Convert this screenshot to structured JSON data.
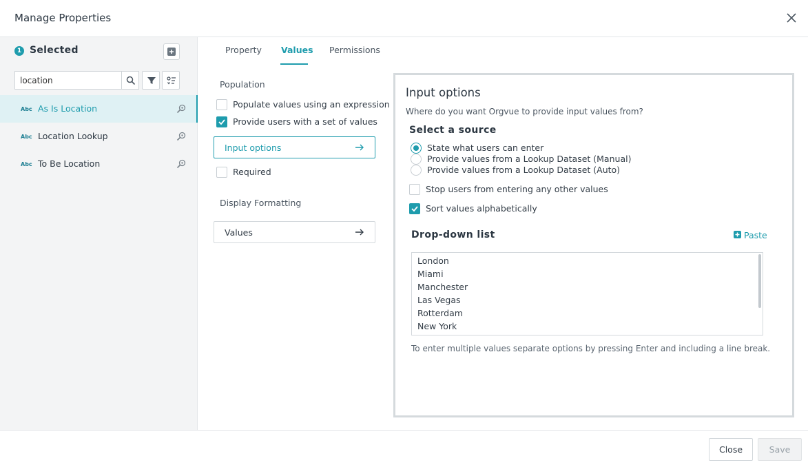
{
  "dialog": {
    "title": "Manage Properties"
  },
  "sidebar": {
    "selected_count": "1",
    "selected_label": "Selected",
    "search": {
      "value": "location",
      "placeholder": ""
    },
    "items": [
      {
        "type_badge": "Abc",
        "label": "As Is Location",
        "active": true
      },
      {
        "type_badge": "Abc",
        "label": "Location Lookup",
        "active": false
      },
      {
        "type_badge": "Abc",
        "label": "To Be Location",
        "active": false
      }
    ]
  },
  "tabs": [
    {
      "label": "Property",
      "active": false
    },
    {
      "label": "Values",
      "active": true
    },
    {
      "label": "Permissions",
      "active": false
    }
  ],
  "values_tab": {
    "population_label": "Population",
    "populate_expression": {
      "label": "Populate values using an expression",
      "checked": false
    },
    "provide_set": {
      "label": "Provide users with a set of values",
      "checked": true
    },
    "input_options_button": "Input options",
    "required": {
      "label": "Required",
      "checked": false
    },
    "display_formatting_label": "Display Formatting",
    "values_button": "Values"
  },
  "input_options": {
    "title": "Input options",
    "subtitle": "Where do you want Orgvue to provide input values from?",
    "source_title": "Select a source",
    "sources": [
      {
        "label": "State what users can enter",
        "selected": true
      },
      {
        "label": "Provide values from a Lookup Dataset (Manual)",
        "selected": false
      },
      {
        "label": "Provide values from a Lookup Dataset (Auto)",
        "selected": false
      }
    ],
    "stop_other": {
      "label": "Stop users from entering any other values",
      "checked": false
    },
    "sort_alpha": {
      "label": "Sort values alphabetically",
      "checked": true
    },
    "dropdown_title": "Drop-down list",
    "paste_label": "Paste",
    "options": [
      "London",
      "Miami",
      "Manchester",
      "Las Vegas",
      "Rotterdam",
      "New York"
    ],
    "hint": "To enter multiple values separate options by pressing Enter and including a line break."
  },
  "footer": {
    "close_label": "Close",
    "save_label": "Save"
  },
  "colors": {
    "accent": "#1e9cad",
    "sidebar_bg": "#f3f4f5",
    "active_row": "#dff1f4"
  },
  "icons": {
    "close": "close-icon",
    "add": "add-icon",
    "search": "search-icon",
    "filter": "filter-icon",
    "sort": "sort-icon",
    "inspect": "zoom-icon",
    "arrow": "arrow-right-icon",
    "paste": "plus-icon"
  }
}
